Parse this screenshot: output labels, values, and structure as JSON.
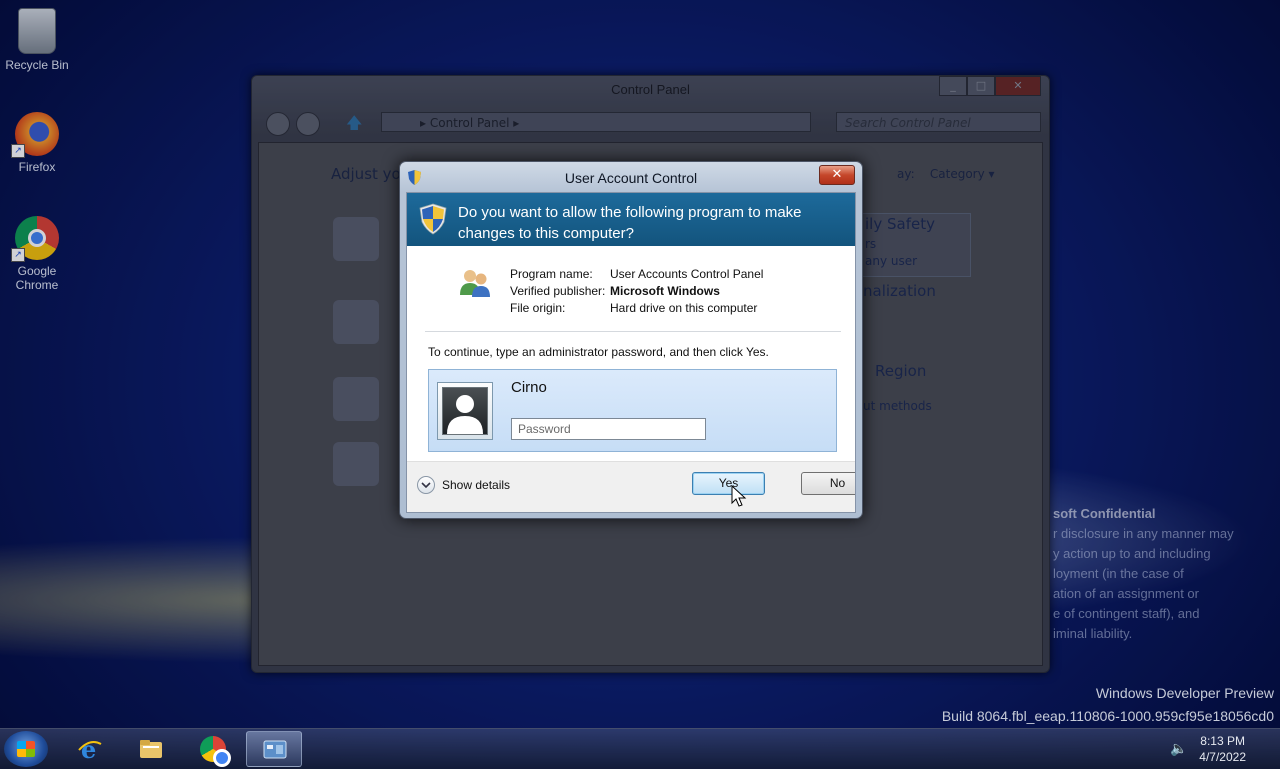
{
  "desktop": {
    "icons": [
      {
        "label": "Recycle Bin",
        "icon": "recycle-bin-icon"
      },
      {
        "label": "Firefox",
        "icon": "firefox-icon"
      },
      {
        "label": "Google Chrome",
        "icon": "chrome-icon"
      }
    ],
    "watermark": {
      "line1": "Windows Developer Preview",
      "line2": "Build 8064.fbl_eeap.110806-1000.959cf95e18056cd0"
    },
    "confidential": {
      "title": "soft Confidential",
      "lines": [
        "r disclosure in any manner may",
        "y action up to and including",
        "loyment (in the case of",
        "ation of an assignment or",
        "e of contingent staff), and",
        "iminal liability."
      ]
    }
  },
  "control_panel": {
    "title": "Control Panel",
    "address": "Control Panel",
    "search_placeholder": "Search Control Panel",
    "heading": "Adjust yo",
    "view_by": "ay:",
    "view_by_value": "Category",
    "right_items": [
      "ily Safety",
      "rs",
      "any user",
      "nalization",
      "Region",
      "ut methods"
    ]
  },
  "uac": {
    "title": "User Account Control",
    "close_label": "✕",
    "question": "Do you want to allow the following program to make changes to this computer?",
    "program_name_label": "Program name:",
    "program_name": "User Accounts Control Panel",
    "publisher_label": "Verified publisher:",
    "publisher": "Microsoft Windows",
    "origin_label": "File origin:",
    "origin": "Hard drive on this computer",
    "instruction": "To continue, type an administrator password, and then click Yes.",
    "user_name": "Cirno",
    "password_placeholder": "Password",
    "show_details": "Show details",
    "yes_label": "Yes",
    "no_label": "No"
  },
  "taskbar": {
    "time": "8:13 PM",
    "date": "4/7/2022"
  }
}
